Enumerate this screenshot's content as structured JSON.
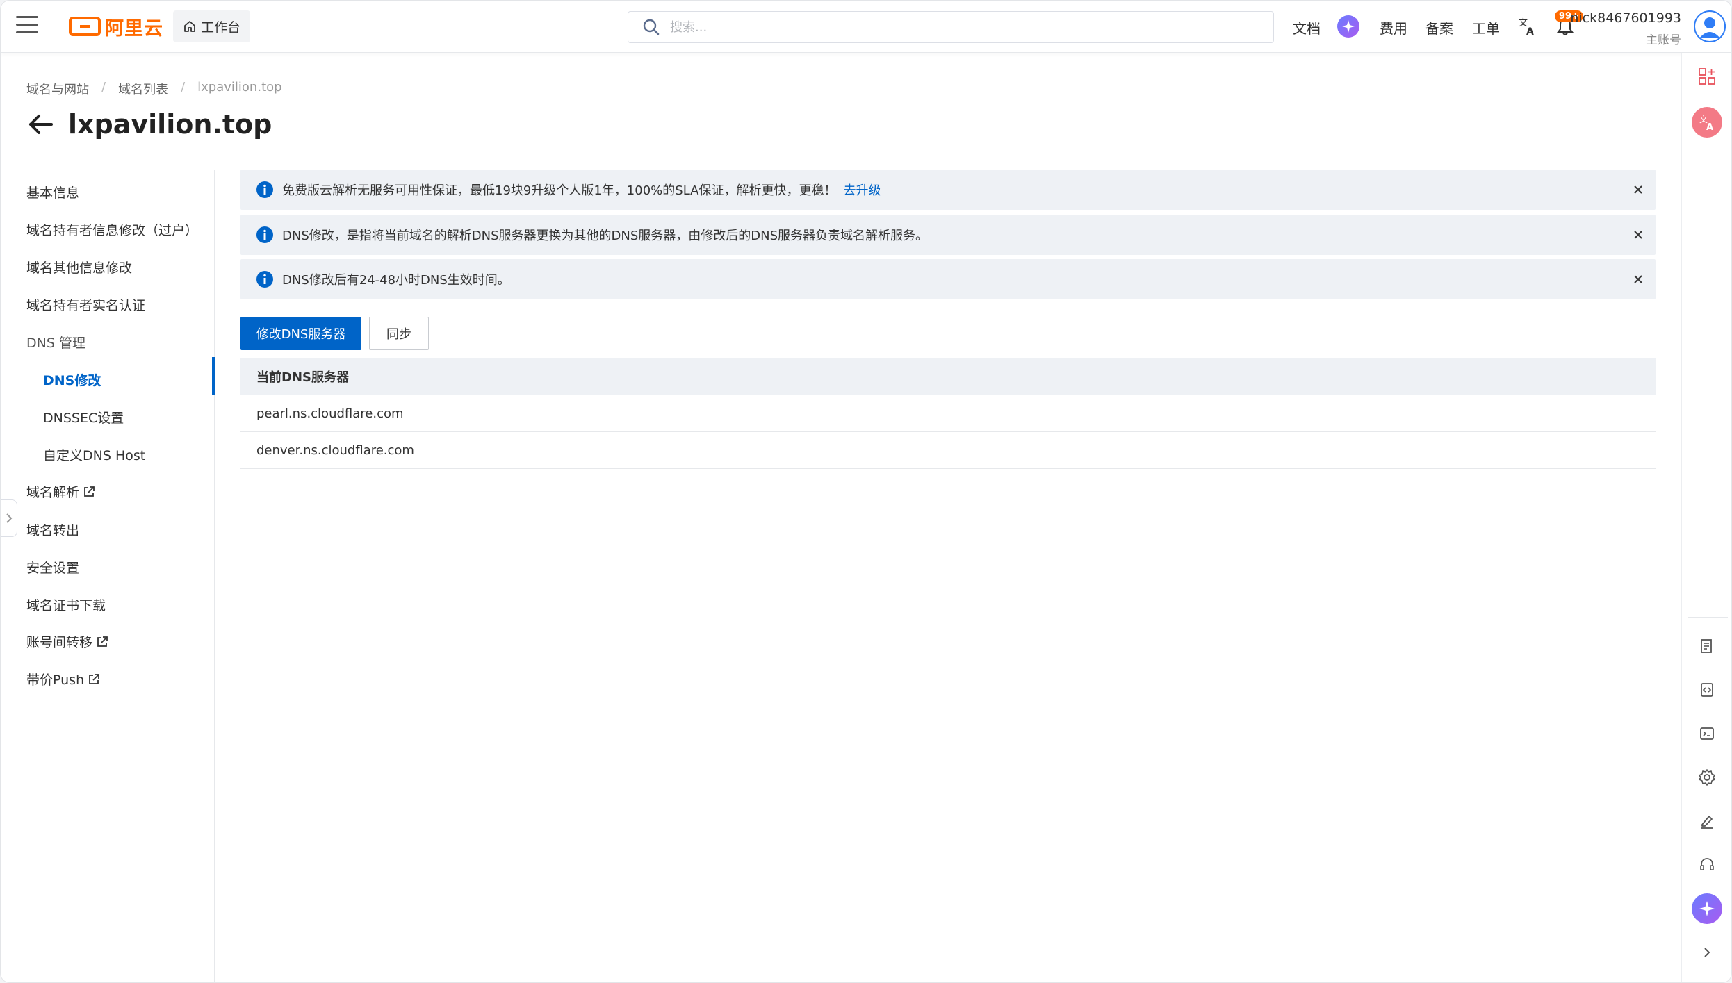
{
  "header": {
    "logo_text": "阿里云",
    "workbench_label": "工作台",
    "search_placeholder": "搜索...",
    "links": [
      "文档",
      "费用",
      "备案",
      "工单"
    ],
    "notification_count": "99+",
    "user_name": "nick8467601993",
    "user_role": "主账号"
  },
  "breadcrumb": [
    "域名与网站",
    "域名列表",
    "lxpavilion.top"
  ],
  "page_title": "lxpavilion.top",
  "nav": {
    "items": [
      {
        "label": "基本信息"
      },
      {
        "label": "域名持有者信息修改（过户）"
      },
      {
        "label": "域名其他信息修改"
      },
      {
        "label": "域名持有者实名认证"
      },
      {
        "label": "DNS 管理"
      },
      {
        "label": "DNS修改"
      },
      {
        "label": "DNSSEC设置"
      },
      {
        "label": "自定义DNS Host"
      },
      {
        "label": "域名解析"
      },
      {
        "label": "域名转出"
      },
      {
        "label": "安全设置"
      },
      {
        "label": "域名证书下载"
      },
      {
        "label": "账号间转移"
      },
      {
        "label": "带价Push"
      }
    ]
  },
  "alerts": [
    {
      "text": "免费版云解析无服务可用性保证，最低19块9升级个人版1年，100%的SLA保证，解析更快，更稳！",
      "link": "去升级"
    },
    {
      "text": "DNS修改，是指将当前域名的解析DNS服务器更换为其他的DNS服务器，由修改后的DNS服务器负责域名解析服务。"
    },
    {
      "text": "DNS修改后有24-48小时DNS生效时间。"
    }
  ],
  "buttons": {
    "modify_dns": "修改DNS服务器",
    "sync": "同步"
  },
  "table": {
    "header": "当前DNS服务器",
    "rows": [
      "pearl.ns.cloudflare.com",
      "denver.ns.cloudflare.com"
    ]
  },
  "colors": {
    "brand": "#ff6a00",
    "primary": "#0064c8",
    "alert_bg": "#eef1f5"
  }
}
